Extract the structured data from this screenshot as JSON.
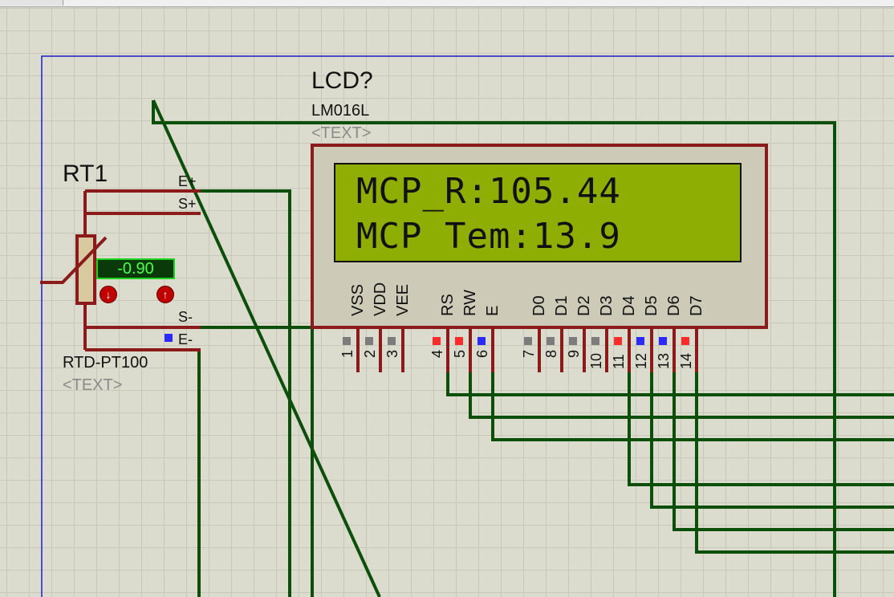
{
  "colors": {
    "wire": "#0b4f0b",
    "component_body": "#8b1a1a",
    "lcd_background": "#8fae04",
    "pin_gray": "#7c7c7c",
    "pin_red": "#ff2a2a",
    "pin_blue": "#2a2aff",
    "sheet_border": "#1c1ccc"
  },
  "rt1": {
    "ref": "RT1",
    "model": "RTD-PT100",
    "text_placeholder": "<TEXT>",
    "readout": "-0.90",
    "pin_labels": {
      "e_plus": "E+",
      "s_plus": "S+",
      "s_minus": "S-",
      "e_minus": "E-"
    },
    "decrement_icon": "arrow-down-icon",
    "increment_icon": "arrow-up-icon"
  },
  "lcd": {
    "ref": "LCD?",
    "model": "LM016L",
    "text_placeholder": "<TEXT>",
    "line1": "MCP_R:105.44",
    "line2": "MCP Tem:13.9",
    "pins": [
      {
        "name": "VSS",
        "num": "1",
        "state": "gray"
      },
      {
        "name": "VDD",
        "num": "2",
        "state": "gray"
      },
      {
        "name": "VEE",
        "num": "3",
        "state": "gray"
      },
      {
        "name": "RS",
        "num": "4",
        "state": "red"
      },
      {
        "name": "RW",
        "num": "5",
        "state": "red"
      },
      {
        "name": "E",
        "num": "6",
        "state": "blue"
      },
      {
        "name": "D0",
        "num": "7",
        "state": "gray"
      },
      {
        "name": "D1",
        "num": "8",
        "state": "gray"
      },
      {
        "name": "D2",
        "num": "9",
        "state": "gray"
      },
      {
        "name": "D3",
        "num": "10",
        "state": "gray"
      },
      {
        "name": "D4",
        "num": "11",
        "state": "red"
      },
      {
        "name": "D5",
        "num": "12",
        "state": "blue"
      },
      {
        "name": "D6",
        "num": "13",
        "state": "blue"
      },
      {
        "name": "D7",
        "num": "14",
        "state": "red"
      }
    ]
  }
}
